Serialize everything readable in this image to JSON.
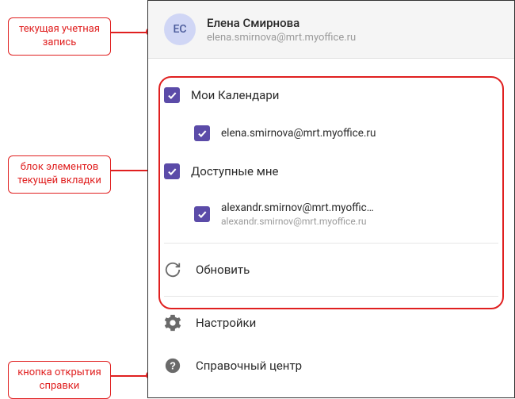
{
  "account": {
    "initials": "ЕС",
    "name": "Елена Смирнова",
    "email": "elena.smirnova@mrt.myoffice.ru"
  },
  "calendars": {
    "my_label": "Мои Календари",
    "my_items": [
      {
        "label": "elena.smirnova@mrt.myoffice.ru"
      }
    ],
    "shared_label": "Доступные мне",
    "shared_items": [
      {
        "label": "alexandr.smirnov@mrt.myoffic…",
        "secondary": "alexandr.smirnov@mrt.myoffice.ru"
      }
    ]
  },
  "actions": {
    "refresh": "Обновить",
    "settings": "Настройки",
    "help": "Справочный центр"
  },
  "callouts": {
    "account": "текущая учетная запись",
    "section": "блок элементов текущей вкладки",
    "help": "кнопка открытия справки"
  }
}
